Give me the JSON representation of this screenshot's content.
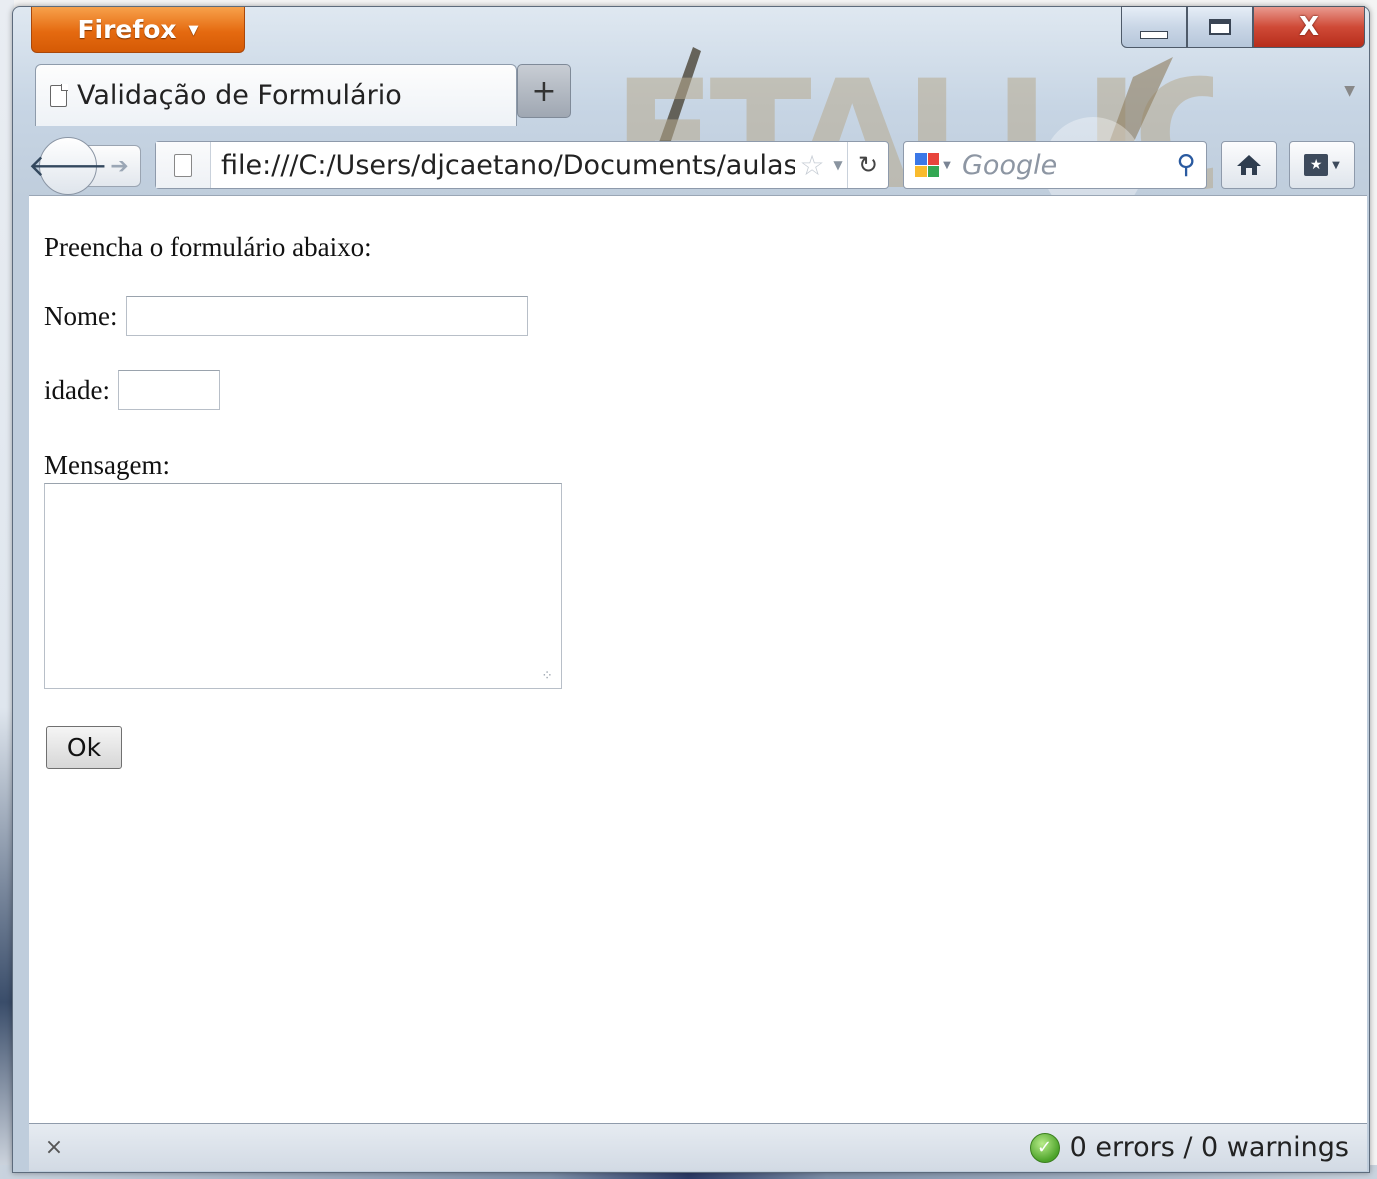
{
  "browser": {
    "menu_button": "Firefox",
    "tab": {
      "title": "Validação de Formulário"
    },
    "new_tab": "+",
    "url": "file:///C:/Users/djcaetano/Documents/aulas,",
    "search_placeholder": "Google",
    "caption": {
      "close": "X"
    }
  },
  "page": {
    "intro": "Preencha o formulário abaixo:",
    "nome_label": "Nome:",
    "nome_value": "",
    "idade_label": "idade:",
    "idade_value": "",
    "mensagem_label": "Mensagem:",
    "mensagem_value": "",
    "ok_button": "Ok"
  },
  "statusbar": {
    "close": "×",
    "validator": "0 errors / 0 warnings"
  },
  "colors": {
    "firefox_orange": "#e56a10",
    "close_red": "#cf4a37",
    "frame_blue": "#c7d5e4"
  },
  "icons": [
    "page-icon",
    "back-icon",
    "forward-icon",
    "star-icon",
    "reload-icon",
    "google-icon",
    "search-icon",
    "home-icon",
    "bookmarks-icon",
    "check-icon"
  ]
}
